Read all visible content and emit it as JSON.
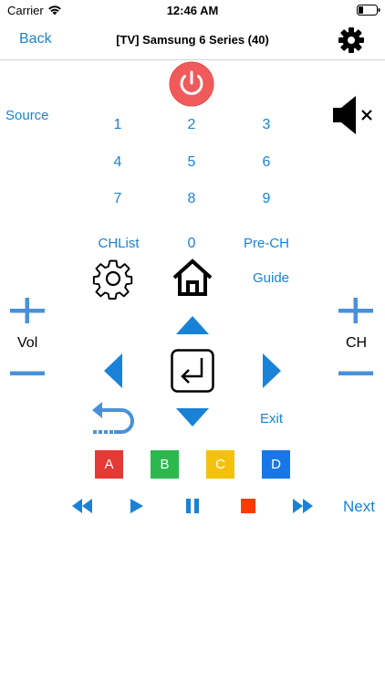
{
  "status_bar": {
    "carrier": "Carrier",
    "time": "12:46 AM"
  },
  "nav": {
    "back_label": "Back",
    "title": "[TV] Samsung 6 Series (40)"
  },
  "remote": {
    "source_label": "Source",
    "digits": [
      "1",
      "2",
      "3",
      "4",
      "5",
      "6",
      "7",
      "8",
      "9"
    ],
    "chlist_label": "CHList",
    "zero_label": "0",
    "prech_label": "Pre-CH",
    "guide_label": "Guide",
    "vol_label": "Vol",
    "ch_label": "CH",
    "exit_label": "Exit",
    "color_buttons": [
      {
        "label": "A",
        "color": "#e53935"
      },
      {
        "label": "B",
        "color": "#2db84d"
      },
      {
        "label": "C",
        "color": "#f4c20d"
      },
      {
        "label": "D",
        "color": "#1877e6"
      }
    ],
    "next_label": "Next"
  },
  "colors": {
    "accent": "#1a82d6",
    "power": "#f15a5a"
  }
}
